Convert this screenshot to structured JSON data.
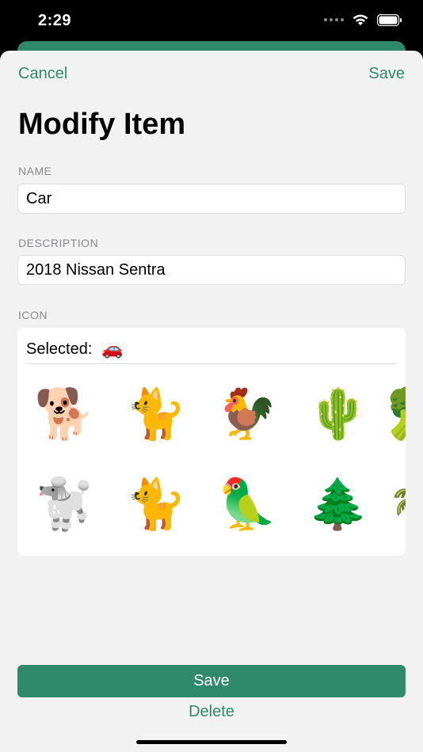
{
  "status_bar": {
    "time": "2:29"
  },
  "nav": {
    "cancel_label": "Cancel",
    "save_label": "Save"
  },
  "title": "Modify Item",
  "form": {
    "name_label": "NAME",
    "name_value": "Car",
    "description_label": "DESCRIPTION",
    "description_value": "2018 Nissan Sentra",
    "icon_label": "ICON",
    "selected_label": "Selected:",
    "selected_icon": "🚗"
  },
  "icons": [
    {
      "emoji": "🐕",
      "name": "dog"
    },
    {
      "emoji": "🐈",
      "name": "cat"
    },
    {
      "emoji": "🐓",
      "name": "rooster"
    },
    {
      "emoji": "🌵",
      "name": "cactus"
    },
    {
      "emoji": "🥦",
      "name": "bush"
    },
    {
      "emoji": "🐩",
      "name": "poodle"
    },
    {
      "emoji": "🐈",
      "name": "cat"
    },
    {
      "emoji": "🦜",
      "name": "parrot"
    },
    {
      "emoji": "🌲",
      "name": "evergreen-tree"
    },
    {
      "emoji": "🌴",
      "name": "palm-tree"
    }
  ],
  "actions": {
    "save_label": "Save",
    "delete_label": "Delete"
  },
  "colors": {
    "accent": "#2f8a6b",
    "background": "#f2f2f2"
  }
}
